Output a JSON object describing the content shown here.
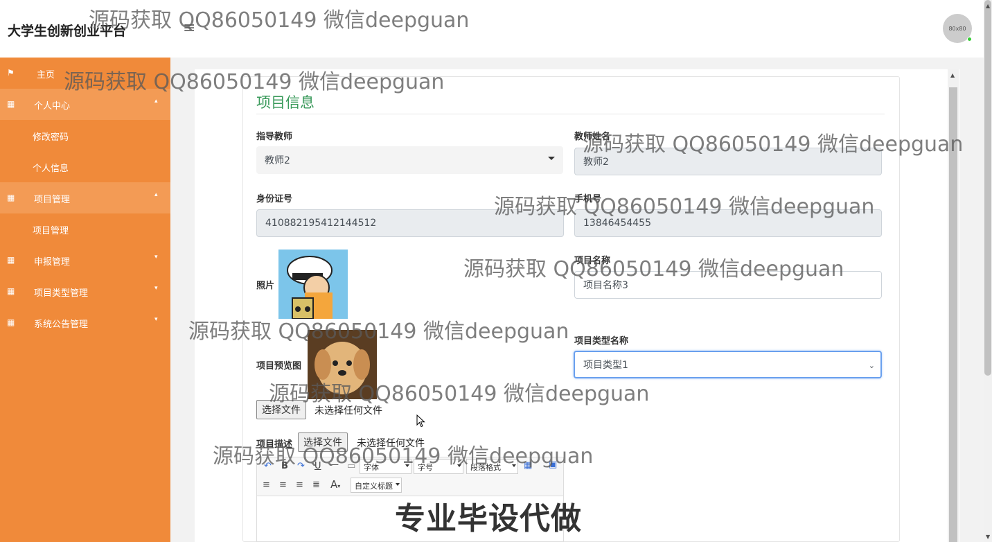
{
  "header": {
    "brand": "大学生创新创业平台",
    "avatar_text": "80x80"
  },
  "sidebar": {
    "home": "主页",
    "groups": [
      {
        "label": "个人中心",
        "children": [
          "修改密码",
          "个人信息"
        ]
      },
      {
        "label": "项目管理",
        "children": [
          "项目管理"
        ]
      },
      {
        "label": "申报管理",
        "children": []
      },
      {
        "label": "项目类型管理",
        "children": []
      },
      {
        "label": "系统公告管理",
        "children": []
      }
    ]
  },
  "form": {
    "title": "项目信息",
    "teacher_label": "指导教师",
    "teacher_value": "教师2",
    "teacher_name_label": "教师姓名",
    "teacher_name_value": "教师2",
    "id_label": "身份证号",
    "id_value": "410882195412144512",
    "phone_label": "手机号",
    "phone_value": "13846454455",
    "photo_label": "照片",
    "project_name_label": "项目名称",
    "project_name_value": "项目名称3",
    "preview_label": "项目预览图",
    "type_label": "项目类型名称",
    "type_value": "项目类型1",
    "file_button": "选择文件",
    "file_none": "未选择任何文件",
    "desc_label": "项目描述"
  },
  "editor": {
    "font": "字体",
    "size": "字号",
    "para": "段落格式",
    "custom_title": "自定义标题"
  },
  "watermarks": [
    "源码获取 QQ86050149 微信deepguan"
  ],
  "promo": "专业毕设代做",
  "colors": {
    "sidebar": "#f08a3a",
    "sidebar_open": "#f39b55",
    "title_green": "#3a9a5b",
    "focus": "#6aa0ee"
  }
}
